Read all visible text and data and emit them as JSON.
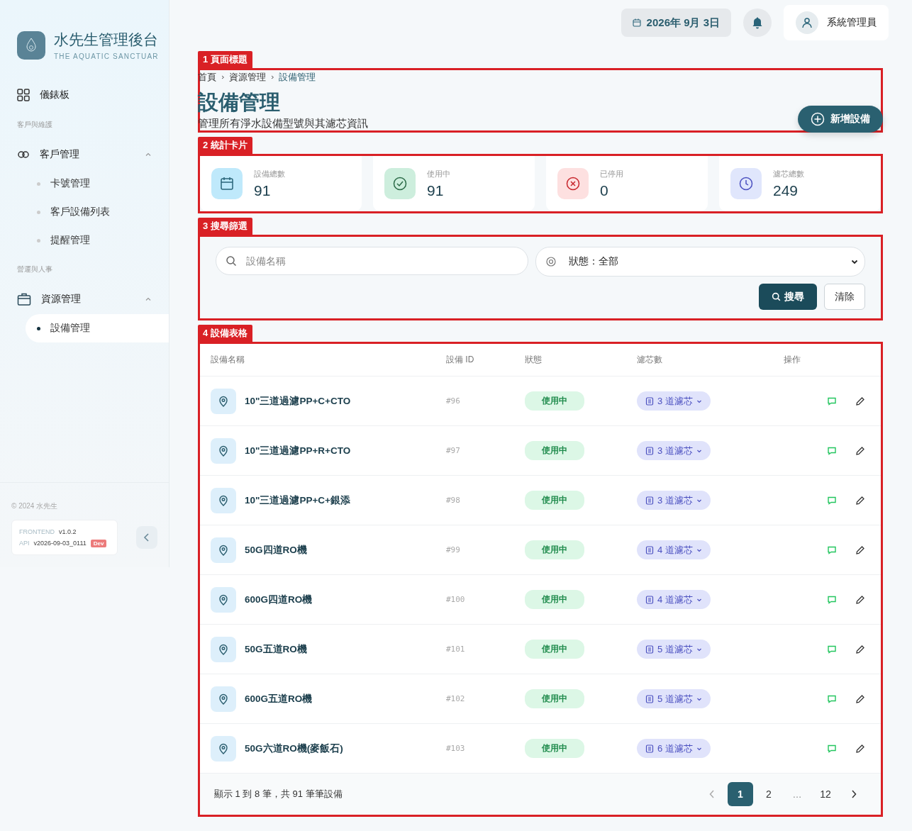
{
  "sidebar": {
    "brand": {
      "title": "水先生管理後台",
      "subtitle": "THE AQUATIC SANCTUAR"
    },
    "items": [
      {
        "kind": "link",
        "label": "儀錶板"
      },
      {
        "kind": "section",
        "label": "客戶與維護"
      },
      {
        "kind": "group",
        "label": "客戶管理",
        "expanded": true,
        "children": [
          {
            "label": "卡號管理",
            "selected": false
          },
          {
            "label": "客戶設備列表",
            "selected": false
          },
          {
            "label": "提醒管理",
            "selected": false
          }
        ]
      },
      {
        "kind": "section",
        "label": "營運與人事"
      },
      {
        "kind": "group",
        "label": "資源管理",
        "expanded": true,
        "children": [
          {
            "label": "設備管理",
            "selected": true
          }
        ]
      }
    ],
    "copyright": "© 2024 水先生",
    "versions": [
      {
        "label": "FRONTEND",
        "value": "v1.0.2"
      },
      {
        "label": "API",
        "value": "v2026-09-03_0111",
        "badge": "Dev"
      }
    ]
  },
  "topbar": {
    "date": "2026年 9月 3日",
    "user": "系統管理員"
  },
  "page_header": {
    "annotation": "1 頁面標題",
    "breadcrumb": [
      "首頁",
      "資源管理",
      "設備管理"
    ],
    "title": "設備管理",
    "subtitle": "管理所有淨水設備型號與其濾芯資訊",
    "add_button": "新增設備"
  },
  "stats": {
    "annotation": "2 統計卡片",
    "cards": [
      {
        "kind": "total",
        "label": "設備總數",
        "value": "91"
      },
      {
        "kind": "active",
        "label": "使用中",
        "value": "91"
      },
      {
        "kind": "stopped",
        "label": "已停用",
        "value": "0"
      },
      {
        "kind": "filters",
        "label": "濾芯總數",
        "value": "249"
      }
    ]
  },
  "filters": {
    "annotation": "3 搜尋篩選",
    "search": {
      "placeholder": "設備名稱"
    },
    "status_select": "狀態：全部",
    "buttons": [
      {
        "kind": "primary",
        "label": "搜尋"
      },
      {
        "kind": "secondary",
        "label": "清除"
      }
    ]
  },
  "table": {
    "annotation": "4 設備表格",
    "columns": [
      "設備名稱",
      "設備 ID",
      "狀態",
      "濾芯數",
      "操作"
    ],
    "rows": [
      {
        "name": "10\"三道過濾PP+C+CTO",
        "id": "#96",
        "status": "使用中",
        "filters": "3 道濾芯"
      },
      {
        "name": "10\"三道過濾PP+R+CTO",
        "id": "#97",
        "status": "使用中",
        "filters": "3 道濾芯"
      },
      {
        "name": "10\"三道過濾PP+C+銀添",
        "id": "#98",
        "status": "使用中",
        "filters": "3 道濾芯"
      },
      {
        "name": "50G四道RO機",
        "id": "#99",
        "status": "使用中",
        "filters": "4 道濾芯"
      },
      {
        "name": "600G四道RO機",
        "id": "#100",
        "status": "使用中",
        "filters": "4 道濾芯"
      },
      {
        "name": "50G五道RO機",
        "id": "#101",
        "status": "使用中",
        "filters": "5 道濾芯"
      },
      {
        "name": "600G五道RO機",
        "id": "#102",
        "status": "使用中",
        "filters": "5 道濾芯"
      },
      {
        "name": "50G六道RO機(麥飯石)",
        "id": "#103",
        "status": "使用中",
        "filters": "6 道濾芯"
      }
    ],
    "summary": "顯示 1 到 8 筆，共 91 筆筆設備",
    "pages": [
      {
        "kind": "page",
        "label": "1",
        "selected": true
      },
      {
        "kind": "page",
        "label": "2",
        "selected": false
      },
      {
        "kind": "ellipsis",
        "label": "…"
      },
      {
        "kind": "page",
        "label": "12",
        "selected": false
      }
    ]
  }
}
